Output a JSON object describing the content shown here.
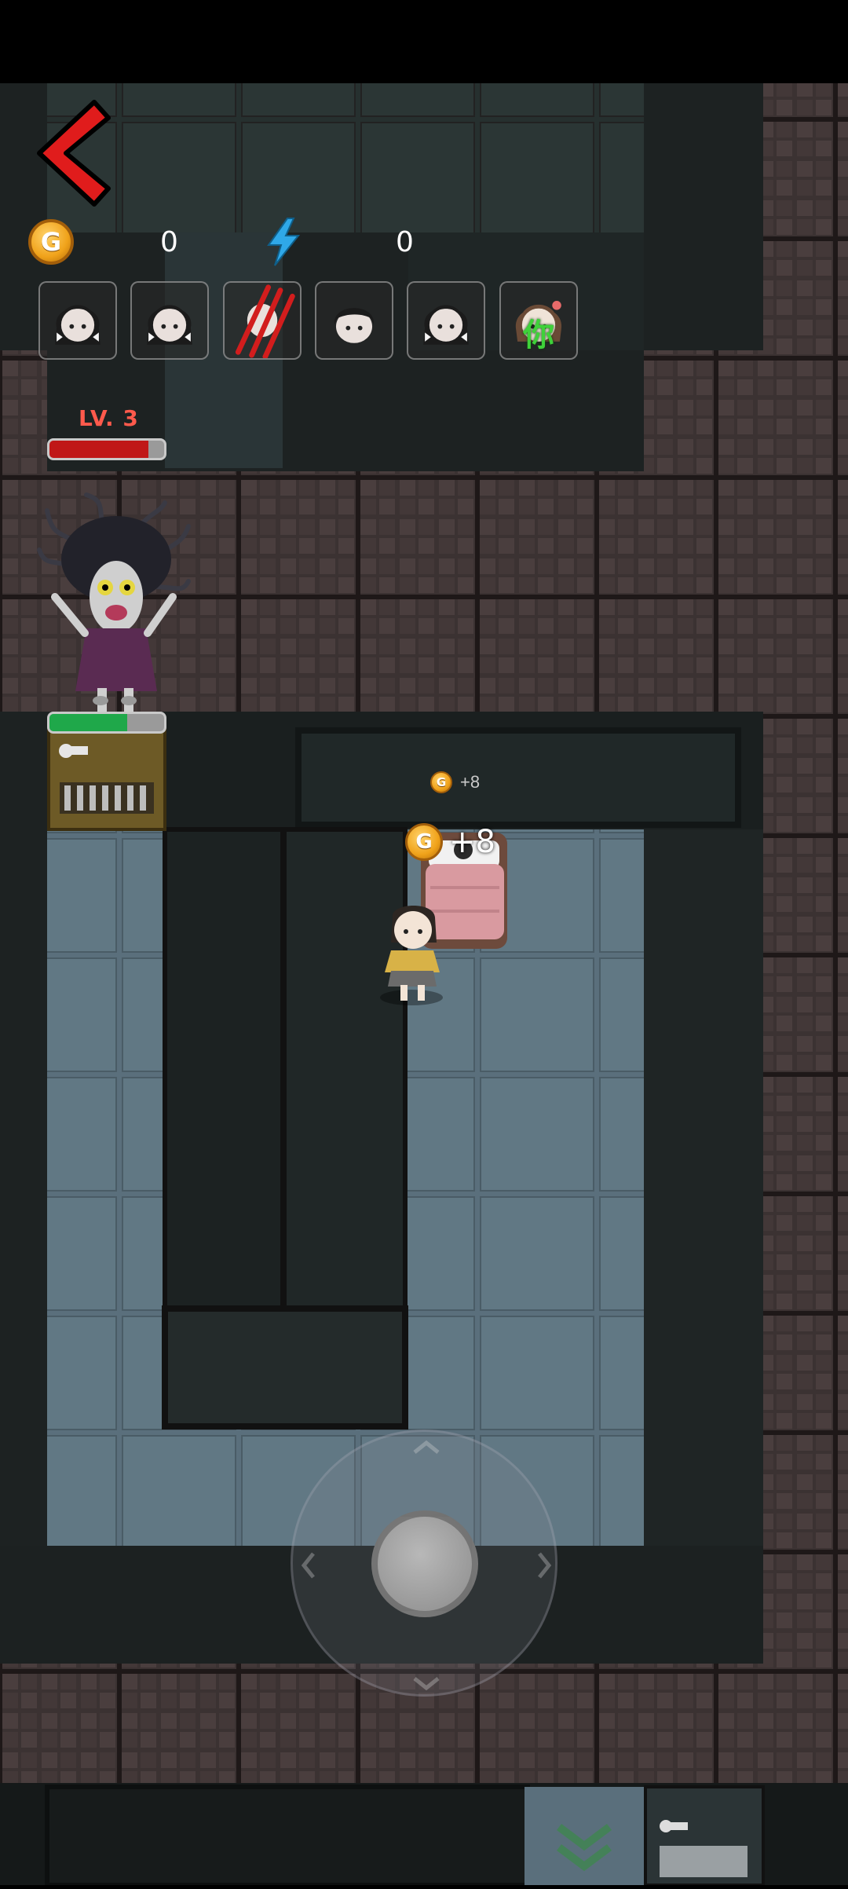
{
  "hud": {
    "coins": "0",
    "energy": "0",
    "coin_glyph": "G",
    "back_icon": "chevron-left-icon"
  },
  "players": [
    {
      "name": "player-slot-1",
      "icon": "girl-bow-avatar-icon",
      "label": ""
    },
    {
      "name": "player-slot-2",
      "icon": "girl-bow-avatar-icon",
      "label": ""
    },
    {
      "name": "player-slot-3",
      "icon": "claw-scratch-avatar-icon",
      "label": ""
    },
    {
      "name": "player-slot-4",
      "icon": "boy-avatar-icon",
      "label": ""
    },
    {
      "name": "player-slot-5",
      "icon": "girl-bow-avatar-icon",
      "label": ""
    },
    {
      "name": "player-slot-you",
      "icon": "girl-avatar-icon",
      "label": "你"
    }
  ],
  "ghost": {
    "level_text": "LV. 3",
    "health": 0.86
  },
  "door": {
    "health": 0.68
  },
  "rewards": {
    "small": "+8",
    "big": "+8"
  },
  "colors": {
    "level_red": "#ff5a4c",
    "health_red": "#c01818",
    "door_green": "#1fa84a",
    "you_label_green": "#3fd13a",
    "floor_blue": "#5b7280",
    "wall_brick": "#3e3434"
  }
}
